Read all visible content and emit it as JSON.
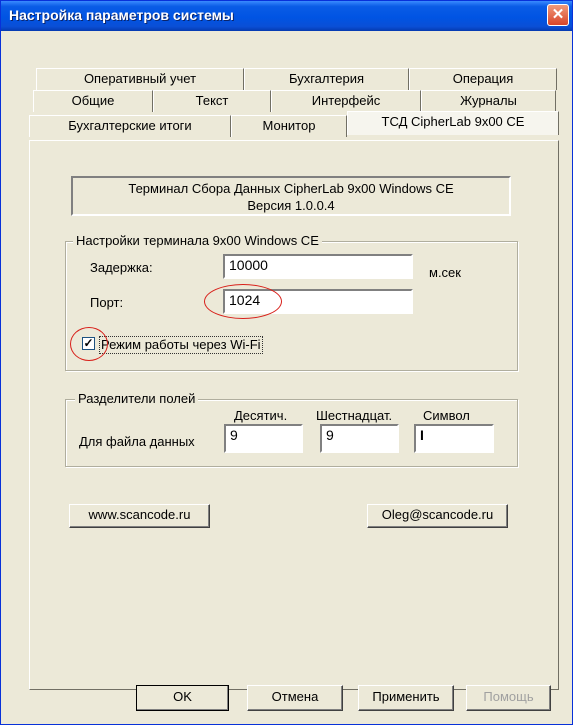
{
  "window": {
    "title": "Настройка параметров системы",
    "close_glyph": "✕"
  },
  "tabs": {
    "row1": [
      "Оперативный учет",
      "Бухгалтерия",
      "Операция"
    ],
    "row2": [
      "Общие",
      "Текст",
      "Интерфейс",
      "Журналы"
    ],
    "row3": [
      "Бухгалтерские итоги",
      "Монитор",
      "ТСД CipherLab 9x00 CE"
    ],
    "active": "ТСД CipherLab 9x00 CE"
  },
  "info": {
    "line1": "Терминал Сбора Данных CipherLab 9x00 Windows CE",
    "line2": "Версия 1.0.0.4"
  },
  "terminal_settings": {
    "caption": "Настройки терминала 9x00 Windows CE",
    "delay_label": "Задержка:",
    "delay_value": "10000",
    "delay_unit": "м.сек",
    "port_label": "Порт:",
    "port_value": "1024",
    "wifi_label": "Режим работы через Wi-Fi",
    "wifi_checked": true,
    "check_glyph": "✓"
  },
  "separators": {
    "caption": "Разделители полей",
    "col_decimal": "Десятич.",
    "col_hex": "Шестнадцат.",
    "col_symbol": "Символ",
    "row_label": "Для файла данных",
    "decimal_value": "9",
    "hex_value": "9",
    "symbol_value": "I"
  },
  "links": {
    "site": "www.scancode.ru",
    "email": "Oleg@scancode.ru"
  },
  "buttons": {
    "ok": "OK",
    "cancel": "Отмена",
    "apply": "Применить",
    "help": "Помощь"
  },
  "colors": {
    "title_bar": "#0054E3",
    "face": "#ECE9D8",
    "annotation": "#D8201A"
  }
}
